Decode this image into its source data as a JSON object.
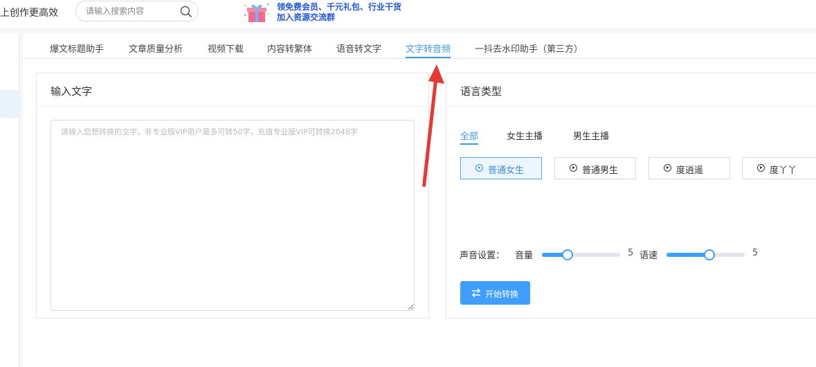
{
  "header": {
    "slogan": "上创作更高效",
    "search": {
      "placeholder": "请输入搜索内容",
      "icon": "search-icon"
    },
    "promo": {
      "line1": "领免费会员、千元礼包、行业干货",
      "line2": "加入资源交流群",
      "icon": "gift-box-icon"
    }
  },
  "tabs": [
    {
      "label": "爆文标题助手",
      "active": false
    },
    {
      "label": "文章质量分析",
      "active": false
    },
    {
      "label": "视频下载",
      "active": false
    },
    {
      "label": "内容转繁体",
      "active": false
    },
    {
      "label": "语音转文字",
      "active": false
    },
    {
      "label": "文字转音频",
      "active": true
    },
    {
      "label": "一抖去水印助手（第三方）",
      "active": false
    }
  ],
  "input_panel": {
    "title": "输入文字",
    "placeholder": "请输入您想转换的文字，非专业版VIP用户最多可转50字，充值专业版VIP可转换2048字"
  },
  "voice_panel": {
    "title": "语言类型",
    "voice_tabs": [
      {
        "label": "全部",
        "active": true
      },
      {
        "label": "女生主播",
        "active": false
      },
      {
        "label": "男生主播",
        "active": false
      }
    ],
    "voices": [
      {
        "label": "普通女生",
        "active": true
      },
      {
        "label": "普通男生",
        "active": false
      },
      {
        "label": "度逍遥",
        "active": false
      },
      {
        "label": "度丫丫",
        "active": false
      }
    ],
    "sound_settings_label": "声音设置：",
    "volume": {
      "label": "音量",
      "value": "5",
      "fraction": 0.33
    },
    "speed": {
      "label": "语速",
      "value": "5",
      "fraction": 0.55
    },
    "start_button": "开始转换"
  },
  "colors": {
    "accent": "#409eff",
    "tab_active": "#3a9ae8",
    "arrow": "#e53935",
    "promo_text": "#1f56d8"
  }
}
